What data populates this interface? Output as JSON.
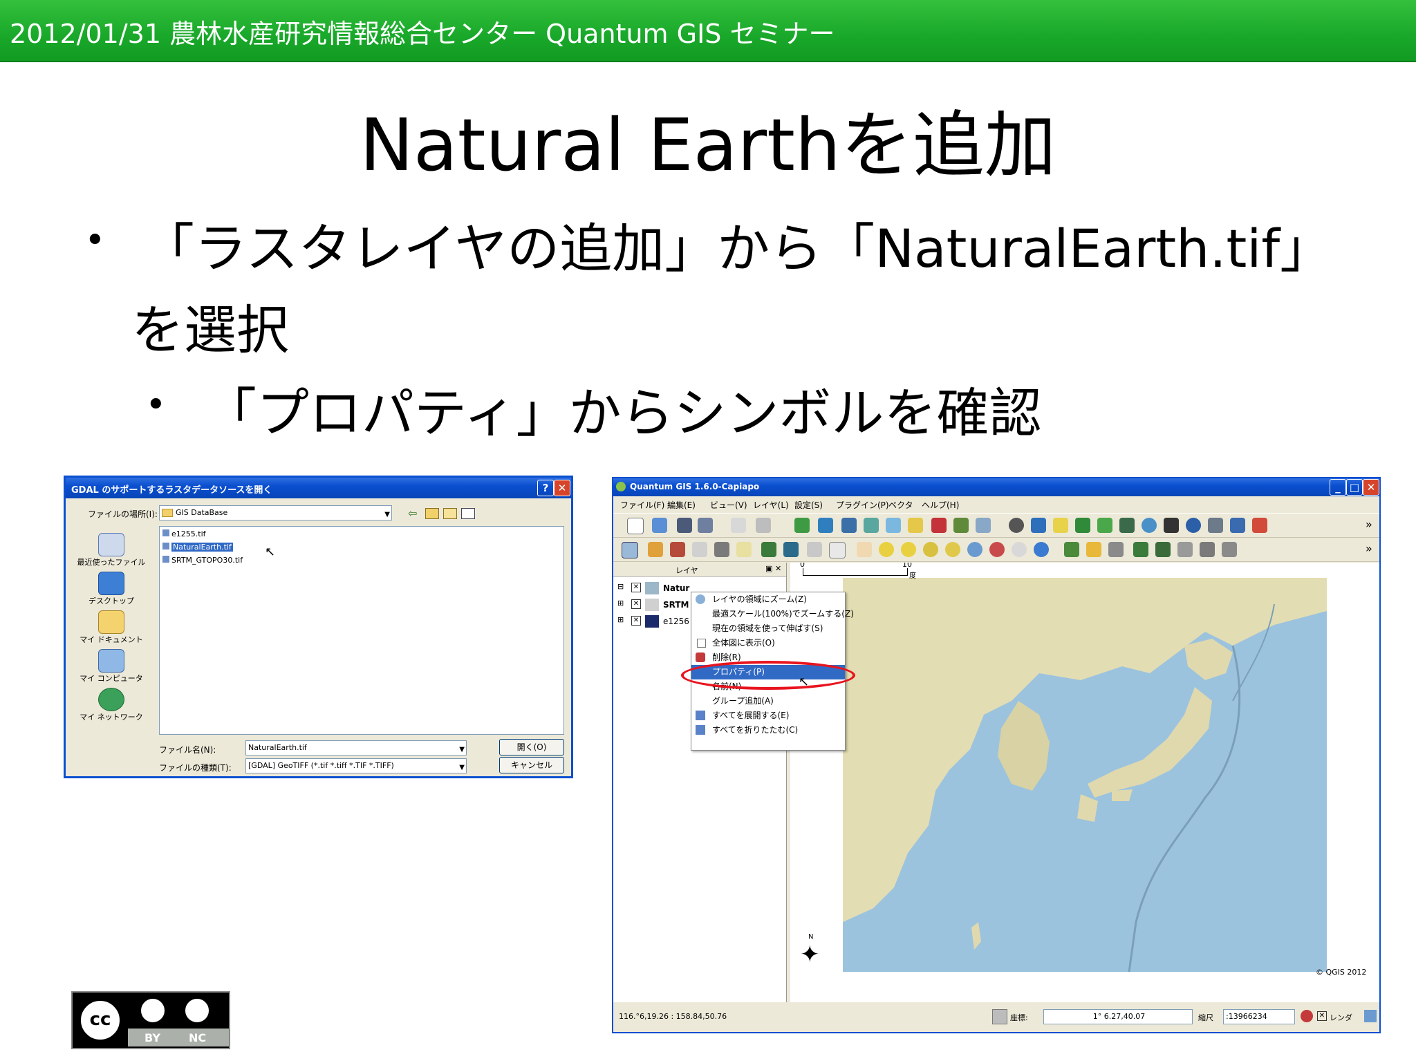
{
  "header": {
    "text": "2012/01/31 農林水産研究情報総合センター Quantum GIS セミナー"
  },
  "slide": {
    "title": "Natural Earthを追加",
    "bullet1_line1": "「ラスタレイヤの追加」から「NaturalEarth.tif」",
    "bullet1_line2": "を選択",
    "bullet2": "「プロパティ」からシンボルを確認",
    "bullet_glyph": "•"
  },
  "dialog": {
    "title": "GDAL のサポートするラスタデータソースを開く",
    "help_glyph": "?",
    "close_glyph": "✕",
    "look_in_label": "ファイルの場所(I):",
    "look_in_value": "GIS DataBase",
    "places": [
      "最近使ったファイル",
      "デスクトップ",
      "マイ ドキュメント",
      "マイ コンピュータ",
      "マイ ネットワーク"
    ],
    "files": [
      "e1255.tif",
      "NaturalEarth.tif",
      "SRTM_GTOPO30.tif"
    ],
    "filename_label": "ファイル名(N):",
    "filename_value": "NaturalEarth.tif",
    "filetype_label": "ファイルの種類(T):",
    "filetype_value": "[GDAL] GeoTIFF (*.tif *.tiff *.TIF *.TIFF)",
    "open_button": "開く(O)",
    "cancel_button": "キャンセル"
  },
  "qgis": {
    "title": "Quantum GIS 1.6.0-Capiapo",
    "menus": [
      "ファイル(F)",
      "編集(E)",
      "ビュー(V)",
      "レイヤ(L)",
      "設定(S)",
      "プラグイン(P)",
      "ベクタ",
      "ヘルプ(H)"
    ],
    "more_glyph": "»",
    "layers_panel_title": "レイヤ",
    "layers": [
      "Natur",
      "SRTM",
      "e1256"
    ],
    "scale_labels": [
      "0",
      "10"
    ],
    "scale_unit": "度",
    "context_menu": [
      "レイヤの領域にズーム(Z)",
      "最適スケール(100%)でズームする(Z)",
      "現在の領域を使って伸ばす(S)",
      "全体図に表示(O)",
      "削除(R)",
      "プロパティ(P)",
      "名前(N)",
      "グループ追加(A)",
      "すべてを展開する(E)",
      "すべてを折りたたむ(C)"
    ],
    "selected_menu_index": 5,
    "north_label": "N",
    "copyright": "© QGIS 2012",
    "status": {
      "coords_left": "116.°6,19.26 : 158.84,50.76",
      "coord_label": "座標:",
      "coord_value": "1° 6.27,40.07",
      "scale_label": "縮尺",
      "scale_value": ":13966234",
      "render_label": "レンダ"
    }
  },
  "license": {
    "cc": "cc",
    "by": "BY",
    "nc": "NC"
  },
  "colors": {
    "header_green": "#19a82a",
    "xp_blue": "#0a4fd0",
    "highlight_red": "#e8141e",
    "sea": "#9cc3de",
    "land": "#e8e2b8"
  }
}
